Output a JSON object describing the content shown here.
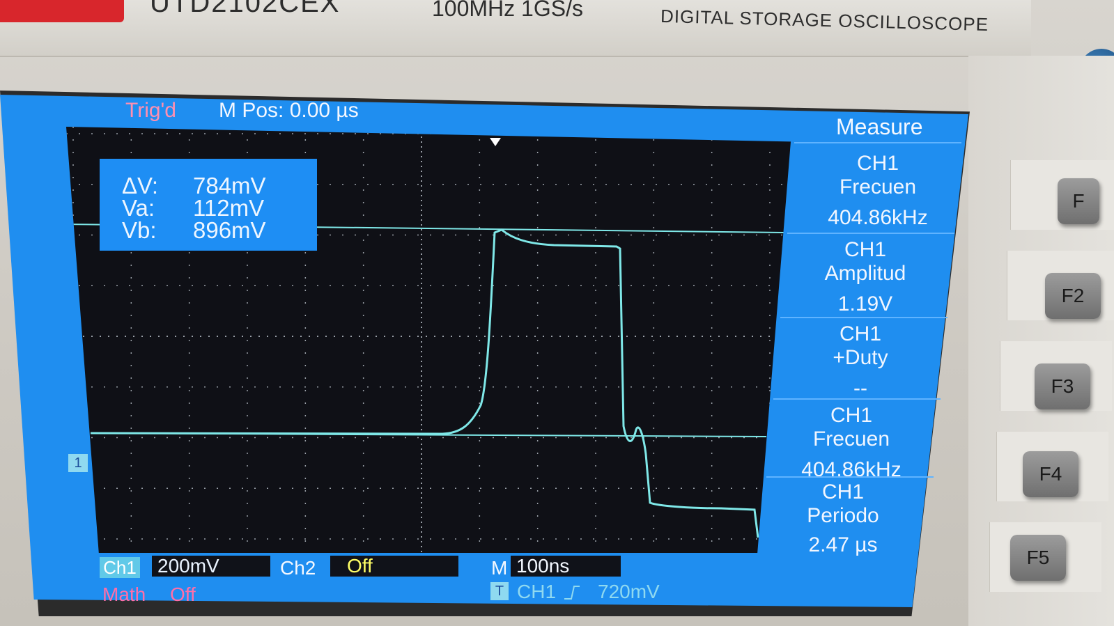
{
  "header": {
    "model_fragment": "UTD2102CEX",
    "spec": "100MHz  1GS/s",
    "label": "DIGITAL STORAGE OSCILLOSCOPE"
  },
  "status": {
    "trigger": "Trig'd",
    "mpos": "M Pos: 0.00 µs"
  },
  "cursor": {
    "dv_label": "ΔV:",
    "dv_value": "784mV",
    "va_label": "Va:",
    "va_value": "112mV",
    "vb_label": "Vb:",
    "vb_value": "896mV"
  },
  "measure": {
    "title": "Measure",
    "items": [
      {
        "line1": "CH1",
        "line2": "Frecuen",
        "value": "404.86kHz"
      },
      {
        "line1": "CH1",
        "line2": "Amplitud",
        "value": "1.19V"
      },
      {
        "line1": "CH1",
        "line2": "+Duty",
        "value": "--"
      },
      {
        "line1": "CH1",
        "line2": "Frecuen",
        "value": "404.86kHz"
      },
      {
        "line1": "CH1",
        "line2": "Periodo",
        "value": "2.47 µs"
      }
    ]
  },
  "bottom": {
    "ch1_label": "Ch1",
    "ch1_scale": "200mV",
    "ch2_label": "Ch2",
    "ch2_state": "Off",
    "time_label": "M",
    "time_scale": "100ns",
    "math_label": "Math",
    "math_state": "Off",
    "trig_icon": "T",
    "trig_source": "CH1",
    "trig_level": "720mV",
    "ch1_marker": "1"
  },
  "fkeys": [
    "F2",
    "F3",
    "F4",
    "F5"
  ],
  "colors": {
    "screen_bg": "#1f8ef0",
    "plot_bg": "#0f1016",
    "trace": "#7fe8e8",
    "trig_text": "#ff8fb0",
    "ch2_text": "#ffff66",
    "math_text": "#ff6ea8"
  }
}
